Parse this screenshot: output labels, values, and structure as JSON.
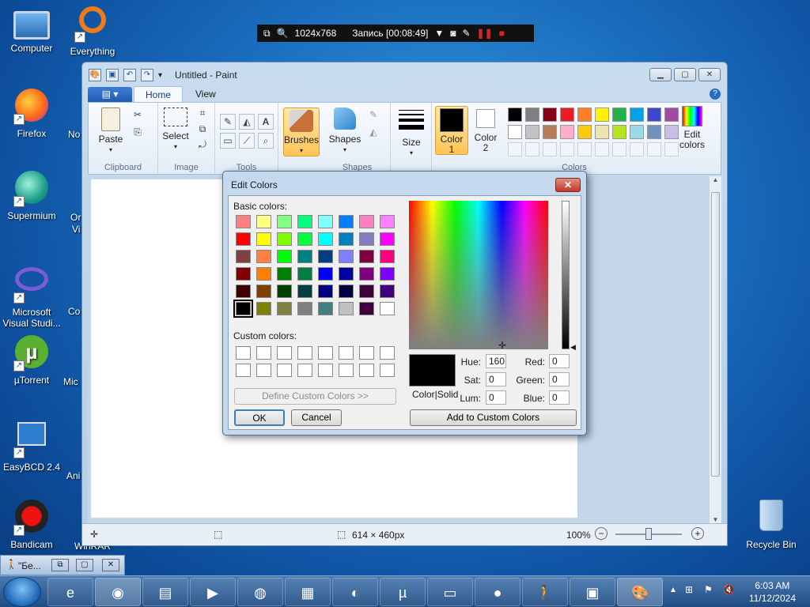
{
  "desktop": {
    "icons": [
      {
        "label": "Computer",
        "icon": "computer-icon"
      },
      {
        "label": "Everything",
        "icon": "everything-icon"
      },
      {
        "label": "Firefox",
        "icon": "firefox-icon"
      },
      {
        "label": "Supermium",
        "icon": "supermium-icon"
      },
      {
        "label": "Microsoft Visual Studi...",
        "icon": "visual-studio-icon"
      },
      {
        "label": "µTorrent",
        "icon": "utorrent-icon"
      },
      {
        "label": "EasyBCD 2.4",
        "icon": "easybcd-icon"
      },
      {
        "label": "Bandicam",
        "icon": "bandicam-icon"
      },
      {
        "label": "Recycle Bin",
        "icon": "recycle-bin-icon"
      }
    ],
    "fragments": [
      "No",
      "Or",
      "Vi",
      "Co",
      "Mic",
      "Ani",
      "WinRAR"
    ]
  },
  "recording_bar": {
    "resolution": "1024x768",
    "status": "Запись [00:08:49]"
  },
  "paint": {
    "title": "Untitled - Paint",
    "tabs": {
      "file": "▤ ▾",
      "home": "Home",
      "view": "View"
    },
    "groups": {
      "clipboard": "Clipboard",
      "image": "Image",
      "tools": "Tools",
      "shapes": "Shapes",
      "colors": "Colors"
    },
    "buttons": {
      "paste": "Paste",
      "select": "Select",
      "brushes": "Brushes",
      "shapes": "Shapes",
      "size": "Size",
      "color1": "Color\n1",
      "color2": "Color\n2",
      "edit_colors": "Edit\ncolors"
    },
    "palette_row1": [
      "#000000",
      "#7f7f7f",
      "#880015",
      "#ed1c24",
      "#ff7f27",
      "#fff200",
      "#22b14c",
      "#00a2e8",
      "#3f48cc",
      "#a349a4"
    ],
    "palette_row2": [
      "#ffffff",
      "#c3c3c3",
      "#b97a57",
      "#ffaec9",
      "#ffc90e",
      "#efe4b0",
      "#b5e61d",
      "#99d9ea",
      "#7092be",
      "#c8bfe7"
    ],
    "status": {
      "size": "614 × 460px",
      "zoom": "100%"
    }
  },
  "edit_colors_dialog": {
    "title": "Edit Colors",
    "close": "✕",
    "basic_colors_label": "Basic colors:",
    "custom_colors_label": "Custom colors:",
    "define_custom": "Define Custom Colors >>",
    "ok": "OK",
    "cancel": "Cancel",
    "add_custom": "Add to Custom Colors",
    "color_solid": "Color|Solid",
    "fields": {
      "hue_label": "Hue:",
      "hue": "160",
      "sat_label": "Sat:",
      "sat": "0",
      "lum_label": "Lum:",
      "lum": "0",
      "red_label": "Red:",
      "red": "0",
      "green_label": "Green:",
      "green": "0",
      "blue_label": "Blue:",
      "blue": "0"
    },
    "basic_colors": [
      [
        "#ff8080",
        "#ffff80",
        "#80ff80",
        "#00ff80",
        "#80ffff",
        "#0080ff",
        "#ff80c0",
        "#ff80ff"
      ],
      [
        "#ff0000",
        "#ffff00",
        "#80ff00",
        "#00ff40",
        "#00ffff",
        "#0080c0",
        "#8080c0",
        "#ff00ff"
      ],
      [
        "#804040",
        "#ff8040",
        "#00ff00",
        "#008080",
        "#004080",
        "#8080ff",
        "#800040",
        "#ff0080"
      ],
      [
        "#800000",
        "#ff8000",
        "#008000",
        "#008040",
        "#0000ff",
        "#0000a0",
        "#800080",
        "#8000ff"
      ],
      [
        "#400000",
        "#804000",
        "#004000",
        "#004040",
        "#000080",
        "#000040",
        "#400040",
        "#400080"
      ],
      [
        "#000000",
        "#808000",
        "#808040",
        "#808080",
        "#408080",
        "#c0c0c0",
        "#400040",
        "#ffffff"
      ]
    ]
  },
  "taskbar": {
    "mini_task": "\"Бе...",
    "time": "6:03 AM",
    "date": "11/12/2024"
  }
}
